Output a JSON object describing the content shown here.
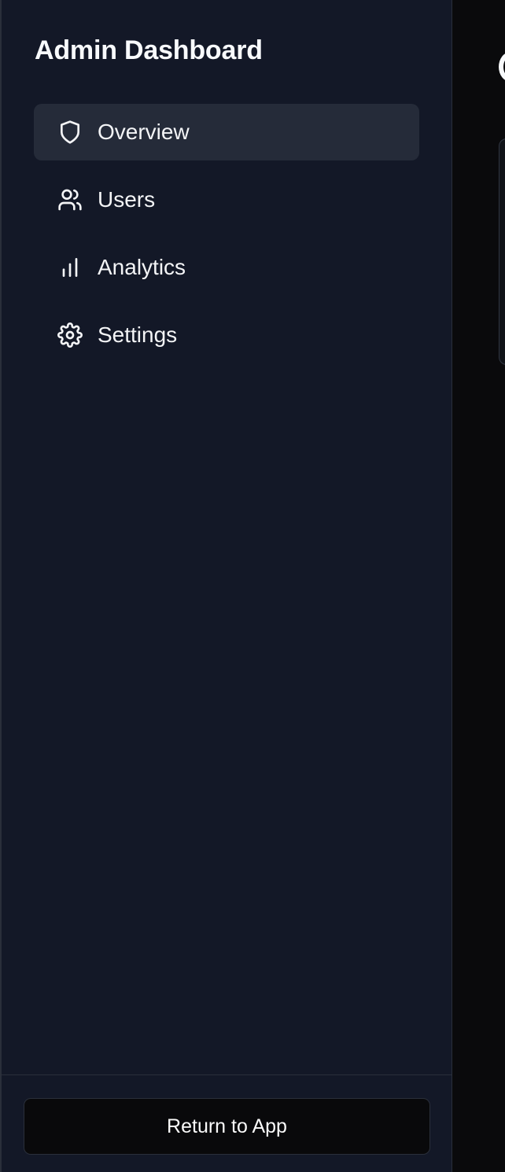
{
  "sidebar": {
    "title": "Admin Dashboard",
    "items": [
      {
        "label": "Overview",
        "icon": "shield-icon",
        "active": true
      },
      {
        "label": "Users",
        "icon": "users-icon",
        "active": false
      },
      {
        "label": "Analytics",
        "icon": "bar-chart-icon",
        "active": false
      },
      {
        "label": "Settings",
        "icon": "gear-icon",
        "active": false
      }
    ],
    "footer": {
      "return_label": "Return to App"
    }
  },
  "colors": {
    "sidebar_background": "#131827",
    "active_item_background": "#252b39",
    "main_background": "#0a0a0c",
    "text": "#f3f4f6",
    "border": "#2a2f3a"
  }
}
